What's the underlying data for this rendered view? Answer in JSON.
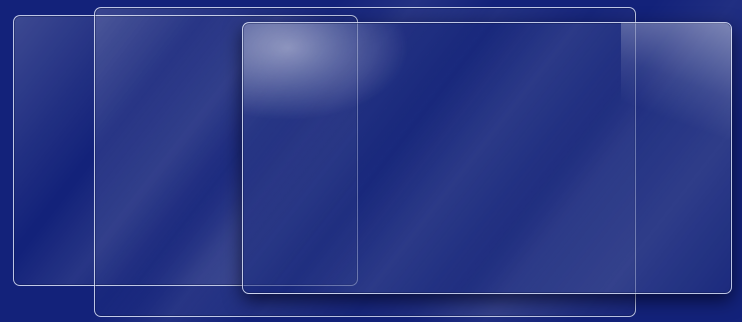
{
  "desktop": {
    "background_color": "#13227a",
    "windows": [
      {
        "name": "left-glass-window",
        "title": ""
      },
      {
        "name": "middle-glass-window",
        "title": ""
      },
      {
        "name": "front-glass-window",
        "title": ""
      }
    ]
  }
}
